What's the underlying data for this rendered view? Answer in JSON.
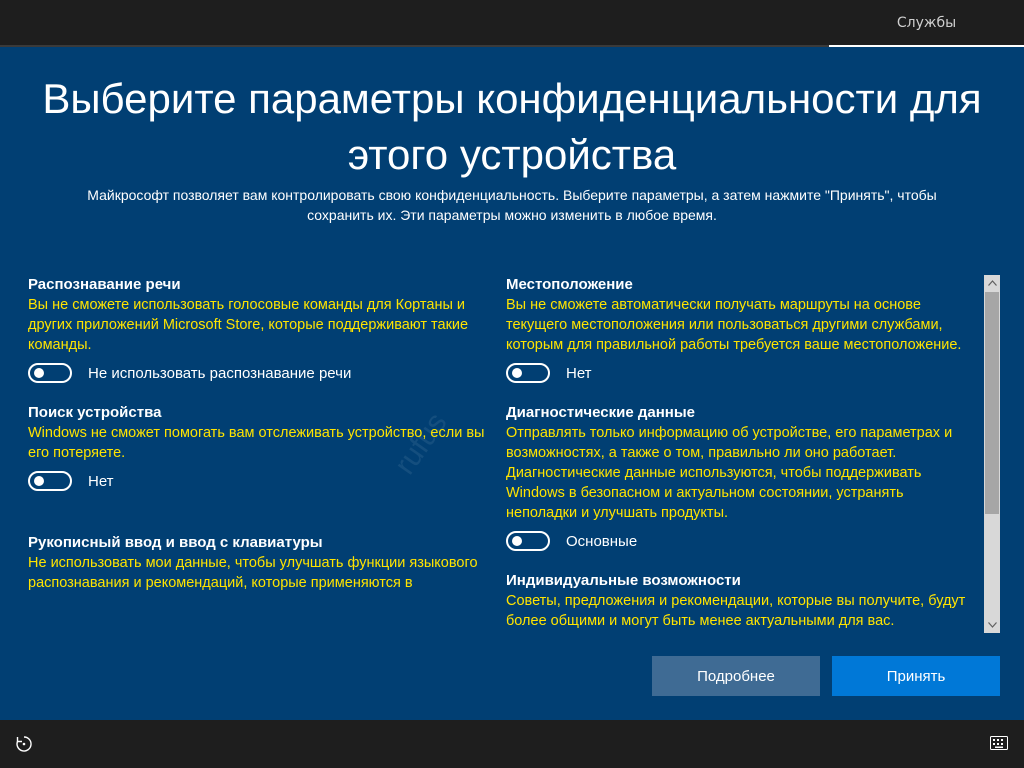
{
  "topbar": {
    "tab_label": "Службы"
  },
  "header": {
    "title_line1": "Выберите параметры конфиденциальности для",
    "title_line2": "этого устройства",
    "subtitle_line1": "Майкрософт позволяет вам контролировать свою конфиденциальность. Выберите параметры, а затем нажмите \"Принять\", чтобы",
    "subtitle_line2": "сохранить их. Эти параметры можно изменить в любое время."
  },
  "settings": {
    "left": [
      {
        "title": "Распознавание речи",
        "description": "Вы не сможете использовать голосовые команды для Кортаны и других приложений Microsoft Store, которые поддерживают такие команды.",
        "toggle_label": "Не использовать распознавание речи",
        "toggle_on": false
      },
      {
        "title": "Поиск устройства",
        "description": "Windows не сможет помогать вам отслеживать устройство, если вы его потеряете.",
        "toggle_label": "Нет",
        "toggle_on": false
      },
      {
        "title": "Рукописный ввод и ввод с клавиатуры",
        "description": "Не использовать мои данные, чтобы улучшать функции языкового распознавания и рекомендаций, которые применяются в"
      }
    ],
    "right": [
      {
        "title": "Местоположение",
        "description": "Вы не сможете автоматически получать маршруты на основе текущего местоположения или пользоваться другими службами, которым для правильной работы требуется ваше местоположение.",
        "toggle_label": "Нет",
        "toggle_on": false
      },
      {
        "title": "Диагностические данные",
        "description": "Отправлять только информацию об устройстве, его параметрах и возможностях, а также о том, правильно ли оно работает. Диагностические данные используются, чтобы поддерживать Windows в безопасном и актуальном состоянии, устранять неполадки и улучшать продукты.",
        "toggle_label": "Основные",
        "toggle_on": false
      },
      {
        "title": "Индивидуальные возможности",
        "description": "Советы, предложения и рекомендации, которые вы получите, будут более общими и могут быть менее актуальными для вас."
      }
    ]
  },
  "watermark": "rufus",
  "buttons": {
    "more_label": "Подробнее",
    "accept_label": "Принять"
  },
  "colors": {
    "background": "#013f73",
    "description_text": "#ffe400",
    "accept_button": "#0078d7",
    "more_button": "#3f6b94",
    "bar": "#1e1e1e"
  },
  "icons": {
    "ease_of_access": "ease-of-access-icon",
    "keyboard": "keyboard-icon",
    "scroll_up": "scroll-up-arrow-icon",
    "scroll_down": "scroll-down-arrow-icon"
  }
}
